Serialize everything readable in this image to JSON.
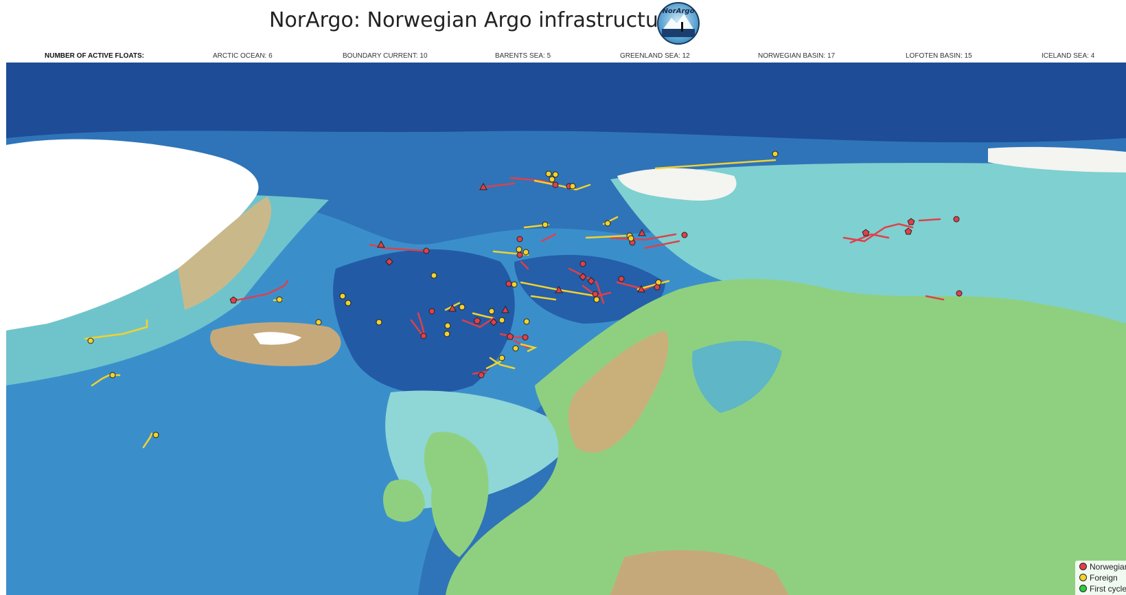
{
  "header": {
    "title": "NorArgo: Norwegian Argo infrastructure",
    "logo_text": "NorArgo"
  },
  "stats": {
    "label": "NUMBER OF ACTIVE FLOATS:",
    "regions": [
      {
        "text": "ARCTIC OCEAN: 6",
        "count": 6
      },
      {
        "text": "BOUNDARY CURRENT: 10",
        "count": 10
      },
      {
        "text": "BARENTS SEA: 5",
        "count": 5
      },
      {
        "text": "GREENLAND SEA: 12",
        "count": 12
      },
      {
        "text": "NORWEGIAN BASIN: 17",
        "count": 17
      },
      {
        "text": "LOFOTEN BASIN: 15",
        "count": 15
      },
      {
        "text": "ICELAND SEA: 4",
        "count": 4
      }
    ]
  },
  "legend": {
    "items": [
      {
        "label": "Norwegian",
        "color": "#e0404a"
      },
      {
        "label": "Foreign",
        "color": "#f2d22e"
      },
      {
        "label": "First cycle",
        "color": "#2ecc40"
      }
    ]
  },
  "colors": {
    "norwegian": "#e0404a",
    "foreign": "#f2d22e",
    "deep_ocean": "#1f4f9a",
    "mid_ocean": "#2f7fc0",
    "shelf": "#7fd0d0",
    "land": "#8fd080",
    "ice": "#ffffff"
  }
}
